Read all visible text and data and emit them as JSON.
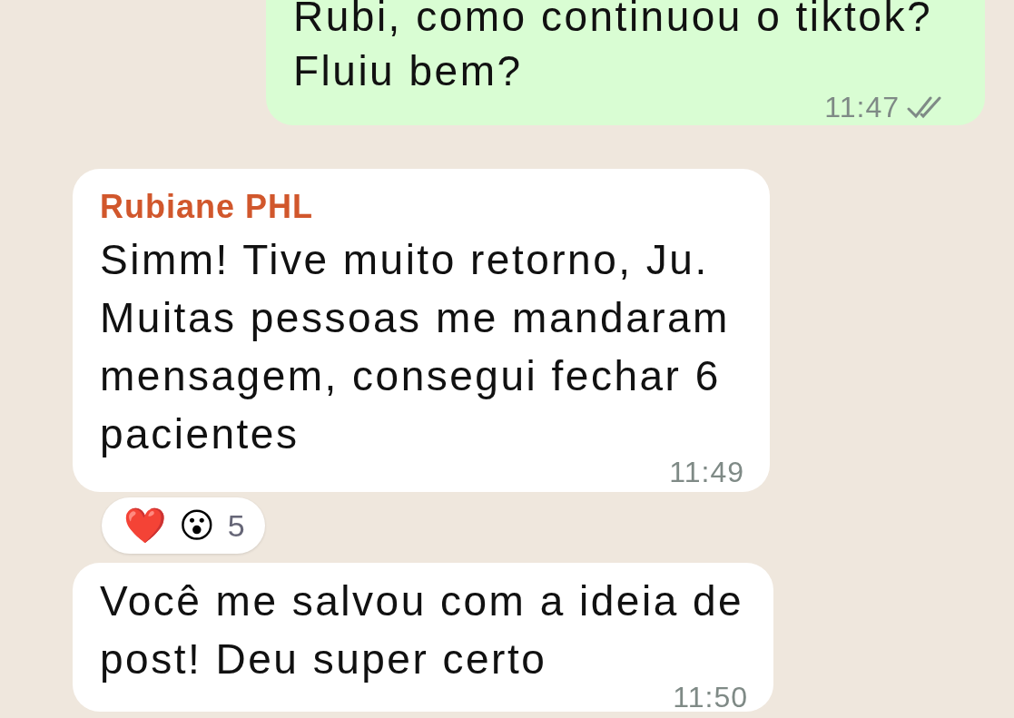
{
  "messages": [
    {
      "kind": "outgoing",
      "text": "Rubi, como continuou o tiktok? Fluiu bem?",
      "time": "11:47",
      "read": false
    },
    {
      "kind": "incoming",
      "sender": "Rubiane PHL",
      "text": "Simm! Tive muito retorno, Ju. Muitas pessoas me mandaram mensagem, consegui fechar 6 pacientes",
      "time": "11:49",
      "reactions": {
        "emojis": [
          "❤️",
          "😮"
        ],
        "count": "5"
      }
    },
    {
      "kind": "incoming",
      "text": "Você me salvou com a ideia de post! Deu super certo",
      "time": "11:50"
    }
  ]
}
